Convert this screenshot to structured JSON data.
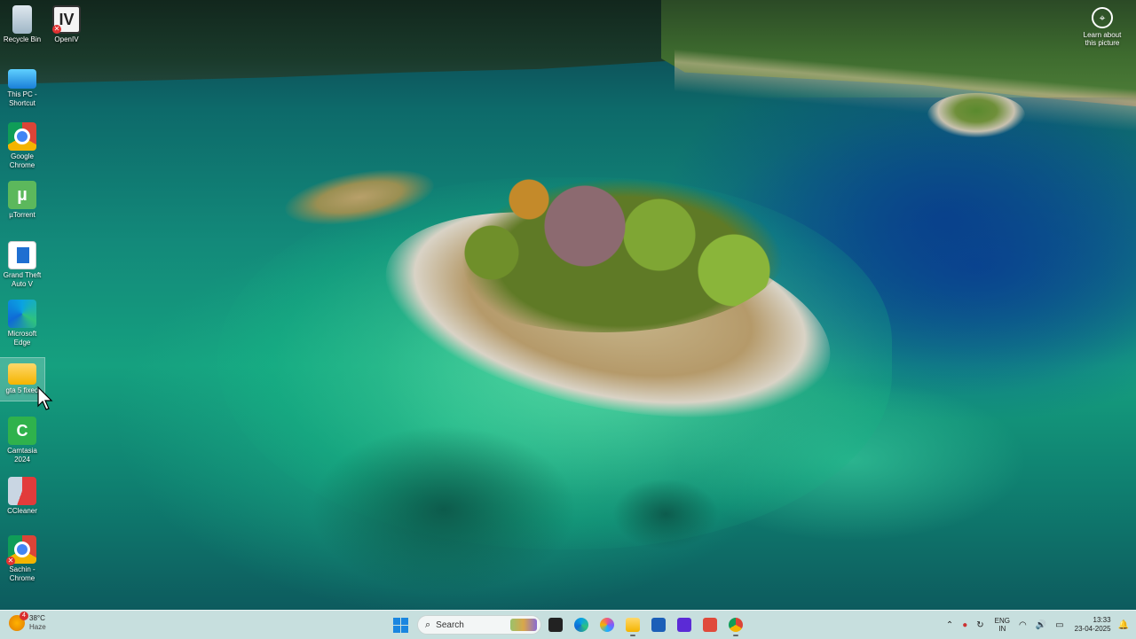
{
  "wallpaper": {
    "learn_about_label": "Learn about this picture",
    "learn_icon": "camera-lens-icon"
  },
  "desktop": {
    "icons": [
      {
        "label": "Recycle Bin",
        "icon": "recycle-bin-icon"
      },
      {
        "label": "OpenIV",
        "icon": "openiv-icon",
        "glyph": "IV"
      },
      {
        "label": "This PC - Shortcut",
        "icon": "this-pc-icon"
      },
      {
        "label": "Google Chrome",
        "icon": "chrome-icon"
      },
      {
        "label": "µTorrent",
        "icon": "utorrent-icon",
        "glyph": "µ"
      },
      {
        "label": "Grand Theft Auto V",
        "icon": "gta-icon"
      },
      {
        "label": "Microsoft Edge",
        "icon": "edge-icon"
      },
      {
        "label": "gta 5 fixed",
        "icon": "folder-icon"
      },
      {
        "label": "Camtasia 2024",
        "icon": "camtasia-icon",
        "glyph": "C"
      },
      {
        "label": "CCleaner",
        "icon": "ccleaner-icon"
      },
      {
        "label": "Sachin - Chrome",
        "icon": "chrome-profile-icon"
      }
    ],
    "badge_x": "✕"
  },
  "taskbar": {
    "weather": {
      "temp": "38°C",
      "condition": "Haze",
      "alerts": "4"
    },
    "search_placeholder": "Search",
    "search_glyph": "⌕",
    "apps": [
      {
        "name": "Task View",
        "icon": "task-view-icon"
      },
      {
        "name": "Microsoft Edge",
        "icon": "edge-icon"
      },
      {
        "name": "Copilot",
        "icon": "copilot-icon"
      },
      {
        "name": "File Explorer",
        "icon": "file-explorer-icon"
      },
      {
        "name": "Microsoft Store",
        "icon": "store-icon"
      },
      {
        "name": "Screen Capture",
        "icon": "capture-icon"
      },
      {
        "name": "Camtasia",
        "icon": "camtasia-icon"
      },
      {
        "name": "Google Chrome",
        "icon": "chrome-icon"
      }
    ],
    "tray": {
      "chevron": "⌃",
      "language_line1": "ENG",
      "language_line2": "IN",
      "wifi_glyph": "◠",
      "volume_glyph": "🔊",
      "battery_glyph": "▭",
      "time": "13:33",
      "date": "23-04-2025",
      "bell_glyph": "🔔"
    }
  }
}
